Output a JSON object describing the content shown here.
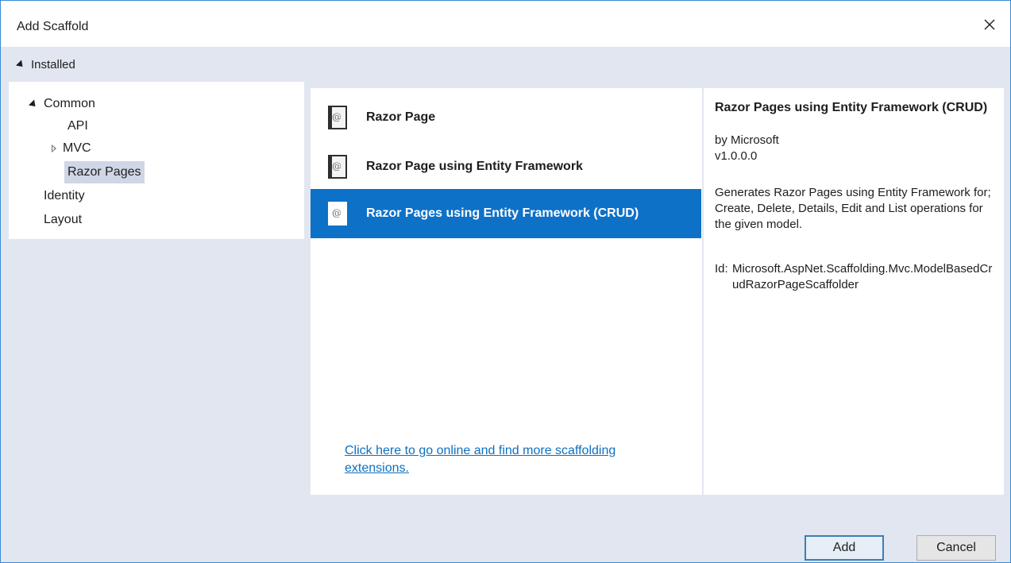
{
  "window": {
    "title": "Add Scaffold"
  },
  "installed": {
    "label": "Installed"
  },
  "tree": {
    "common": "Common",
    "api": "API",
    "mvc": "MVC",
    "razor_pages": "Razor Pages",
    "identity": "Identity",
    "layout": "Layout"
  },
  "templates": [
    {
      "label": "Razor Page"
    },
    {
      "label": "Razor Page using Entity Framework"
    },
    {
      "label": "Razor Pages using Entity Framework (CRUD)"
    }
  ],
  "online_link": "Click here to go online and find more scaffolding extensions.",
  "details": {
    "title": "Razor Pages using Entity Framework (CRUD)",
    "author": "by Microsoft",
    "version": "v1.0.0.0",
    "description": "Generates Razor Pages using Entity Framework for; Create, Delete, Details, Edit and List operations for the given model.",
    "id_label": "Id:",
    "id_value": "Microsoft.AspNet.Scaffolding.Mvc.ModelBasedCrudRazorPageScaffolder"
  },
  "buttons": {
    "add": "Add",
    "cancel": "Cancel"
  },
  "icons": {
    "close": "close-icon",
    "template": "razor-page-icon"
  },
  "colors": {
    "accent": "#0e71c8",
    "link": "#0e70c0",
    "selected_tree": "#cfd6e5"
  }
}
